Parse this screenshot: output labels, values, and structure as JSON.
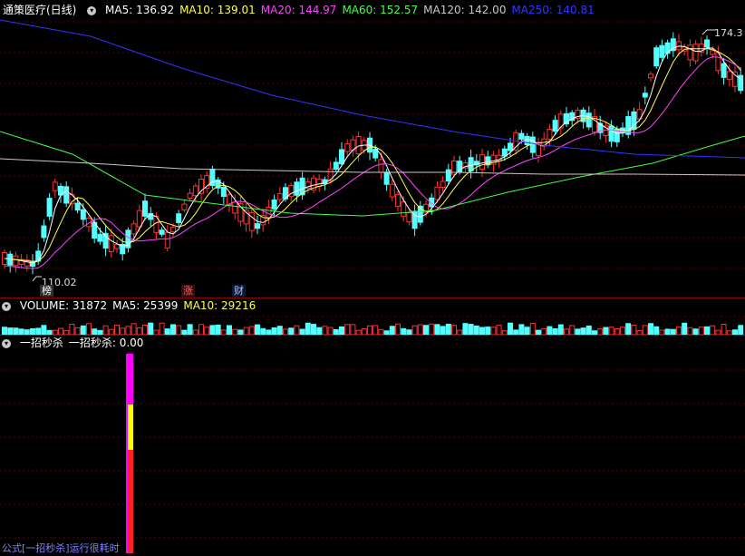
{
  "main_panel": {
    "title": "通策医疗(日线)",
    "ma_labels": [
      {
        "text": "MA5: 136.92",
        "color": "#ffffff"
      },
      {
        "text": "MA10: 139.01",
        "color": "#ffff55"
      },
      {
        "text": "MA20: 144.97",
        "color": "#ff44ff"
      },
      {
        "text": "MA60: 152.57",
        "color": "#44ff44"
      },
      {
        "text": "MA120: 142.00",
        "color": "#c8c8c8"
      },
      {
        "text": "MA250: 140.81",
        "color": "#3333ff"
      }
    ],
    "high_label": "174.3",
    "low_label": "110.02",
    "tags": [
      {
        "text": "榜",
        "color": "#ffffff"
      },
      {
        "text": "涨",
        "color": "#ff6060"
      },
      {
        "text": "财",
        "color": "#a0c0ff"
      }
    ]
  },
  "volume_panel": {
    "labels": [
      {
        "text": "VOLUME: 31872",
        "color": "#ffffff"
      },
      {
        "text": "MA5: 25399",
        "color": "#ffffff"
      },
      {
        "text": "MA10: 29216",
        "color": "#ffff55"
      }
    ]
  },
  "indicator_panel": {
    "labels": [
      {
        "text": "一招秒杀",
        "color": "#ffffff"
      },
      {
        "text": "一招秒杀: 0.00",
        "color": "#ffffff"
      }
    ],
    "status_text": "公式[一招秒杀]运行很耗时"
  },
  "colors": {
    "up": "#ff3030",
    "down": "#54ffff",
    "grid": "#8b0000",
    "bar_magenta": "#ff00ff",
    "bar_yellow": "#ffff00",
    "bar_red": "#ff2020"
  }
}
